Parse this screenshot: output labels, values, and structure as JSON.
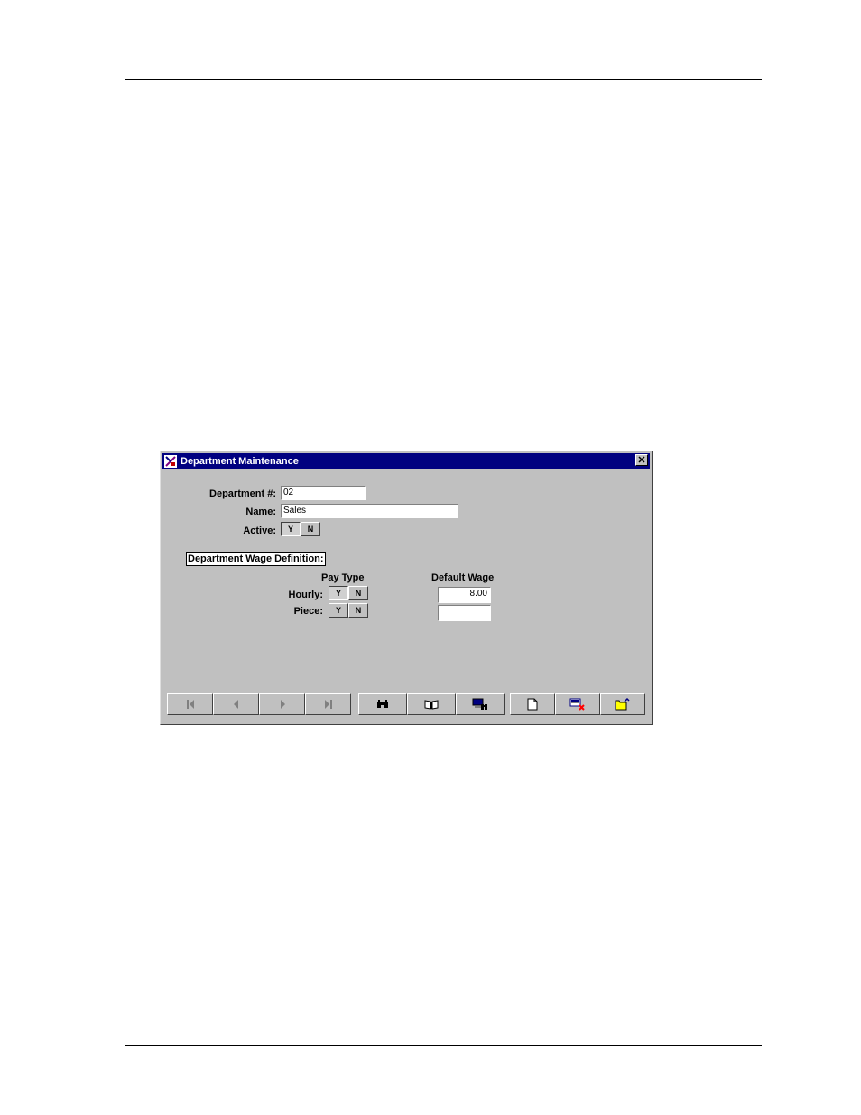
{
  "window": {
    "title": "Department Maintenance",
    "close_label": "✕"
  },
  "form": {
    "department_label": "Department #:",
    "department_value": "02",
    "name_label": "Name:",
    "name_value": "Sales",
    "active_label": "Active:",
    "active_yes": "Y",
    "active_no": "N",
    "active_selected": "Y"
  },
  "wage_definition": {
    "group_title": "Department Wage Definition:",
    "pay_type_header": "Pay Type",
    "default_wage_header": "Default Wage",
    "rows": [
      {
        "label": "Hourly:",
        "yes": "Y",
        "no": "N",
        "selected": "Y",
        "wage": "8.00"
      },
      {
        "label": "Piece:",
        "yes": "Y",
        "no": "N",
        "selected": "",
        "wage": ""
      }
    ]
  },
  "toolbar": {
    "navigation": [
      "first-record-icon",
      "previous-record-icon",
      "next-record-icon",
      "last-record-icon"
    ],
    "search": [
      "binoculars-find-icon",
      "book-lookup-icon",
      "computer-search-icon"
    ],
    "actions": [
      "new-document-icon",
      "delete-record-icon",
      "open-folder-icon"
    ]
  }
}
